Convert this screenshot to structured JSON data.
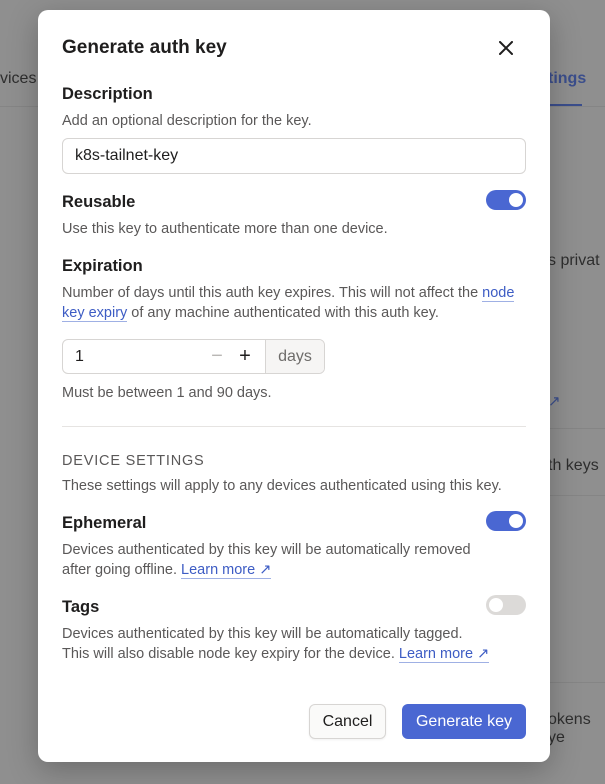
{
  "background": {
    "tab_left": "vices",
    "tab_active": "tings",
    "text_1": "s privat",
    "text_2": "th keys",
    "text_3": "okens ye",
    "link_arrow": "↗"
  },
  "modal": {
    "title": "Generate auth key",
    "close_icon": "×"
  },
  "description": {
    "label": "Description",
    "help": "Add an optional description for the key.",
    "value": "k8s-tailnet-key"
  },
  "reusable": {
    "label": "Reusable",
    "help": "Use this key to authenticate more than one device.",
    "enabled": true
  },
  "expiration": {
    "label": "Expiration",
    "help_before": "Number of days until this auth key expires. This will not affect the ",
    "help_link": "node key expiry",
    "help_after": " of any machine authenticated with this auth key.",
    "value": "1",
    "minus": "−",
    "plus": "+",
    "unit": "days",
    "note": "Must be between 1 and 90 days."
  },
  "device_settings": {
    "heading": "DEVICE SETTINGS",
    "help": "These settings will apply to any devices authenticated using this key."
  },
  "ephemeral": {
    "label": "Ephemeral",
    "help_line1": "Devices authenticated by this key will be automatically removed",
    "help_line2": "after going offline. ",
    "learn_more": "Learn more ↗",
    "enabled": true
  },
  "tags": {
    "label": "Tags",
    "help_line1": "Devices authenticated by this key will be automatically tagged.",
    "help_line2": "This will also disable node key expiry for the device. ",
    "learn_more": "Learn more ↗",
    "enabled": false
  },
  "actions": {
    "cancel": "Cancel",
    "generate": "Generate key"
  },
  "colors": {
    "accent": "#4a67d2",
    "link": "#3d5cc4"
  }
}
